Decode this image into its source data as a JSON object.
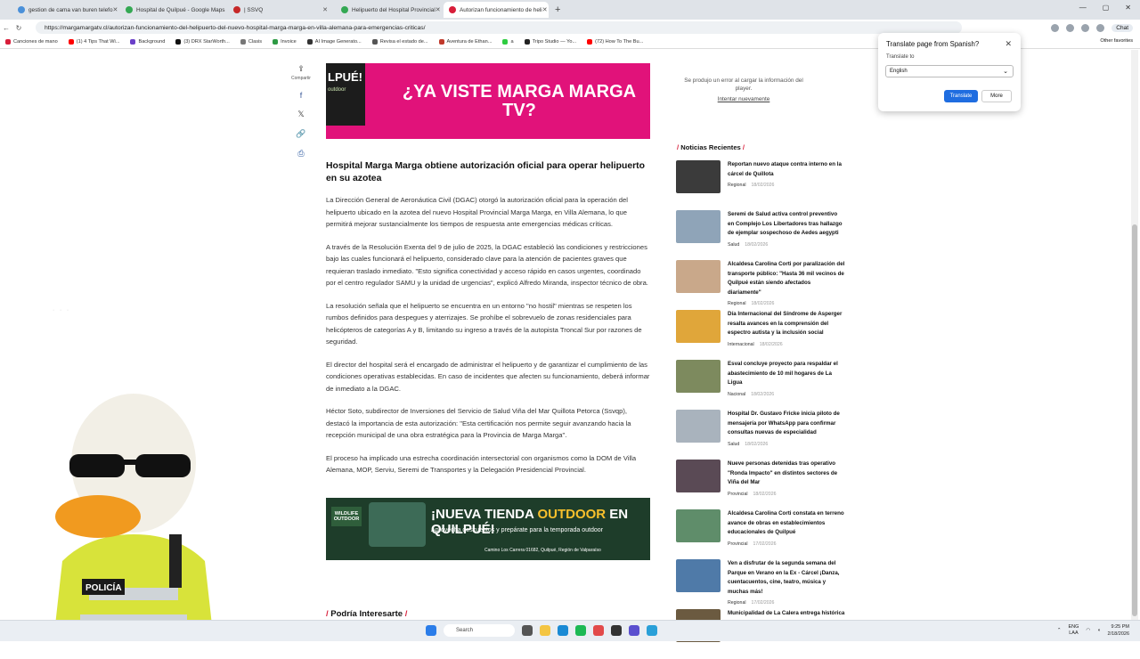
{
  "browser": {
    "tabs": [
      {
        "label": "gestion de cama van buren telefo",
        "color": "#4a90d9"
      },
      {
        "label": "Hospital de Quilpué - Google Maps",
        "color": "#34a853"
      },
      {
        "label": "| SSVQ",
        "color": "#c62828"
      },
      {
        "label": "Helipuerto del Hospital Provincial",
        "color": "#34a853"
      },
      {
        "label": "Autorizan funcionamiento de heli",
        "color": "#d81e3a"
      }
    ],
    "url": "https://margamargatv.cl/autorizan-funcionamiento-del-helipuerto-del-nuevo-hospital-marga-marga-en-villa-alemana-para-emergencias-criticas/",
    "chat_label": "Chat",
    "bookmarks": [
      "Canciones de mano",
      "(1) 4 Tips That Wi...",
      "Background",
      "(3) DRX StarWorth...",
      "Clasis",
      "Invoice",
      "AI Image Generato...",
      "Revisa el estado de...",
      "Aventura de Ethan...",
      "a",
      "Tripo Studio — Yo...",
      "(72) How To The Bu..."
    ],
    "other_favorites": "Other favorites"
  },
  "share": {
    "label": "Compartir"
  },
  "banner_top": {
    "left_text": "LPUÉ!",
    "left_sub": "outdoor",
    "headline": "¿YA VISTE MARGA MARGA TV?"
  },
  "article": {
    "title": "Hospital Marga Marga obtiene autorización oficial para operar helipuerto en su azotea",
    "paragraphs": [
      "La Dirección General de Aeronáutica Civil (DGAC) otorgó la autorización oficial para la operación del helipuerto ubicado en la azotea del nuevo Hospital Provincial Marga Marga, en Villa Alemana, lo que permitirá mejorar sustancialmente los tiempos de respuesta ante emergencias médicas críticas.",
      "A través de la Resolución Exenta del 9 de julio de 2025, la DGAC estableció las condiciones y restricciones bajo las cuales funcionará el helipuerto, considerado clave para la atención de pacientes graves que requieran traslado inmediato. \"Esto significa conectividad y acceso rápido en casos urgentes, coordinado por el centro regulador SAMU y la unidad de urgencias\", explicó Alfredo Miranda, inspector técnico de obra.",
      "La resolución señala que el helipuerto se encuentra en un entorno \"no hostil\" mientras se respeten los rumbos definidos para despegues y aterrizajes. Se prohíbe el sobrevuelo de zonas residenciales para helicópteros de categorías A y B, limitando su ingreso a través de la autopista Troncal Sur por razones de seguridad.",
      "El director del hospital será el encargado de administrar el helipuerto y de garantizar el cumplimiento de las condiciones operativas establecidas. En caso de incidentes que afecten su funcionamiento, deberá informar de inmediato a la DGAC.",
      "Héctor Soto, subdirector de Inversiones del Servicio de Salud Viña del Mar Quillota Petorca (Ssvqp), destacó la importancia de esta autorización: \"Esta certificación nos permite seguir avanzando hacia la recepción municipal de una obra estratégica para la Provincia de Marga Marga\".",
      "El proceso ha implicado una estrecha coordinación intersectorial con organismos como la DOM de Villa Alemana, MOP, Serviu, Seremi de Transportes y la Delegación Presidencial Provincial."
    ]
  },
  "banner_bottom": {
    "logo": "WILDLIFE OUTDOOR",
    "headline_a": "¡NUEVA TIENDA ",
    "headline_b": "OUTDOOR",
    "headline_c": " EN QUILPUÉ!",
    "sub": "Aprovecha descuentos y prepárate para la temporada outdoor",
    "address": "Camino Los Carrera 01682, Quilpué, Región de Valparaíso"
  },
  "podria": "Podría Interesarte",
  "player": {
    "error": "Se produjo un error al cargar la información del player.",
    "retry": "Intentar nuevamente"
  },
  "sidebar": {
    "title": "Noticias Recientes",
    "news": [
      {
        "title": "Reportan nuevo ataque contra interno en la cárcel de Quillota",
        "cat": "Regional",
        "date": "18/02/2026",
        "color": "#3b3b3b"
      },
      {
        "title": "Seremi de Salud activa control preventivo en Complejo Los Libertadores tras hallazgo de ejemplar sospechoso de Aedes aegypti",
        "cat": "Salud",
        "date": "18/02/2026",
        "color": "#8fa4b8"
      },
      {
        "title": "Alcaldesa Carolina Corti por paralización del transporte público: \"Hasta 36 mil vecinos de Quilpué están siendo afectados diariamente\"",
        "cat": "Regional",
        "date": "18/02/2026",
        "color": "#c9a88a"
      },
      {
        "title": "Día Internacional del Síndrome de Asperger resalta avances en la comprensión del espectro autista y la inclusión social",
        "cat": "Internacional",
        "date": "18/02/2026",
        "color": "#e0a63a"
      },
      {
        "title": "Esval concluye proyecto para respaldar el abastecimiento de 10 mil hogares de La Ligua",
        "cat": "Nacional",
        "date": "18/02/2026",
        "color": "#7d8a5e"
      },
      {
        "title": "Hospital Dr. Gustavo Fricke inicia piloto de mensajería por WhatsApp para confirmar consultas nuevas de especialidad",
        "cat": "Salud",
        "date": "18/02/2026",
        "color": "#a9b3bd"
      },
      {
        "title": "Nueve personas detenidas tras operativo \"Ronda Impacto\" en distintos sectores de Viña del Mar",
        "cat": "Provincial",
        "date": "18/02/2026",
        "color": "#5a4a55"
      },
      {
        "title": "Alcaldesa Carolina Corti constata en terreno avance de obras en establecimientos educacionales de Quilpué",
        "cat": "Provincial",
        "date": "17/02/2026",
        "color": "#5f8d6a"
      },
      {
        "title": "Ven a disfrutar de la segunda semana del Parque en Verano en la Ex - Cárcel ¡Danza, cuentacuentos, cine, teatro, música y muchas más!",
        "cat": "Regional",
        "date": "17/02/2026",
        "color": "#4f7aa8"
      },
      {
        "title": "Municipalidad de La Calera entrega histórica",
        "cat": "",
        "date": "",
        "color": "#6b5a40"
      }
    ]
  },
  "translate": {
    "title": "Translate page from Spanish?",
    "to_label": "Translate to",
    "language": "English",
    "translate_btn": "Translate",
    "more_btn": "More"
  },
  "taskbar": {
    "search": "Search",
    "lang1": "ENG",
    "lang2": "LAA",
    "time": "9:25 PM",
    "date": "2/18/2026"
  }
}
